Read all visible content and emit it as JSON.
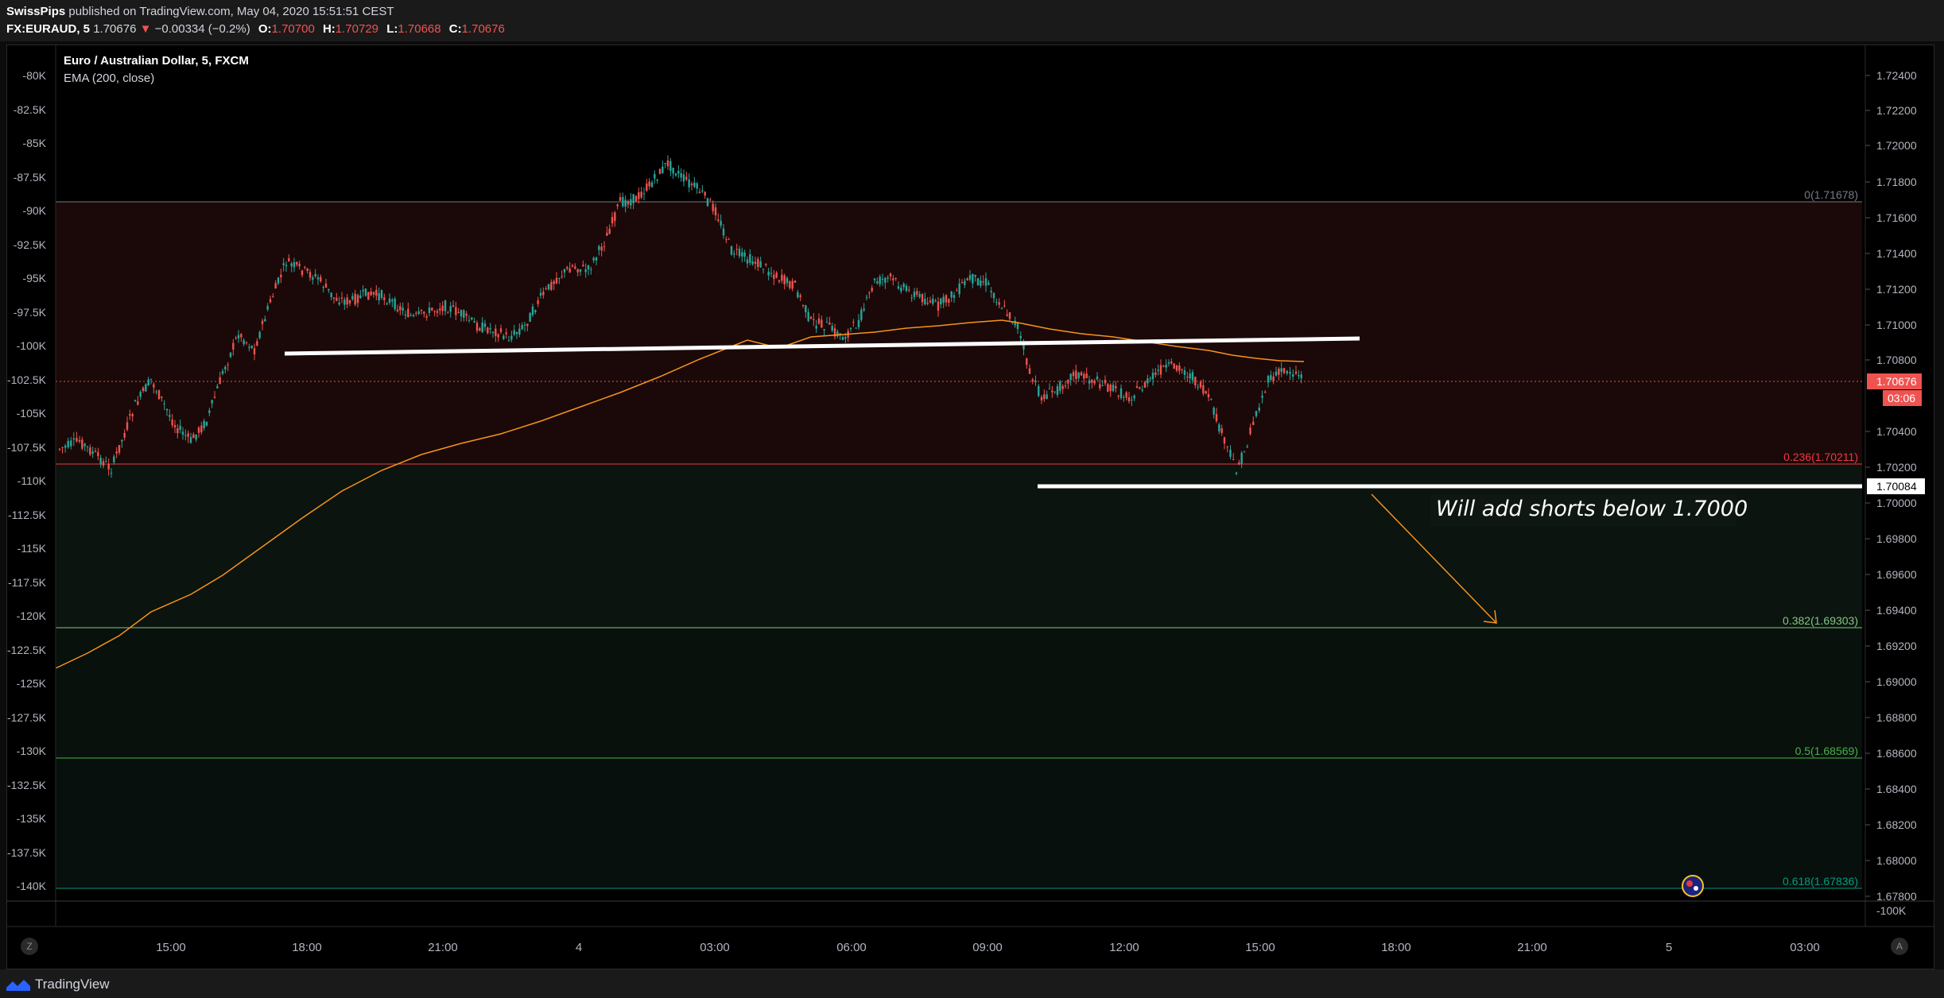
{
  "header": {
    "author": "SwissPips",
    "published_text": "published on TradingView.com, May 04, 2020 15:51:51 CEST",
    "symbol": "FX:EURAUD, 5",
    "last": "1.70676",
    "arrow": "▼",
    "change": "−0.00334 (−0.2%)",
    "o_label": "O:",
    "o_value": "1.70700",
    "h_label": "H:",
    "h_value": "1.70729",
    "l_label": "L:",
    "l_value": "1.70668",
    "c_label": "C:",
    "c_value": "1.70676"
  },
  "legend": {
    "title": "Euro / Australian Dollar, 5, FXCM",
    "indicator": "EMA (200, close)"
  },
  "annotation": {
    "text": "Will add shorts below 1.7000"
  },
  "price_scale": {
    "labels": [
      "1.72400",
      "1.72200",
      "1.72000",
      "1.71800",
      "1.71600",
      "1.71400",
      "1.71200",
      "1.71000",
      "1.70800",
      "1.70400",
      "1.70200",
      "1.70000",
      "1.69800",
      "1.69600",
      "1.69400",
      "1.69200",
      "1.69000",
      "1.68800",
      "1.68600",
      "1.68400",
      "1.68200",
      "1.68000",
      "1.67800"
    ],
    "current_price_tag": "1.70676",
    "countdown_tag": "03:06",
    "line_tag": "1.70084"
  },
  "left_scale": {
    "labels": [
      "-80K",
      "-82.5K",
      "-85K",
      "-87.5K",
      "-90K",
      "-92.5K",
      "-95K",
      "-97.5K",
      "-100K",
      "-102.5K",
      "-105K",
      "-107.5K",
      "-110K",
      "-112.5K",
      "-115K",
      "-117.5K",
      "-120K",
      "-122.5K",
      "-125K",
      "-127.5K",
      "-130K",
      "-132.5K",
      "-135K",
      "-137.5K",
      "-140K"
    ],
    "bottom_right_label": "-100K"
  },
  "fib_levels": [
    {
      "label": "0(1.71678)",
      "color": "#787b86"
    },
    {
      "label": "0.236(1.70211)",
      "color": "#f23645"
    },
    {
      "label": "0.382(1.69303)",
      "color": "#81c784"
    },
    {
      "label": "0.5(1.68569)",
      "color": "#4caf50"
    },
    {
      "label": "0.618(1.67836)",
      "color": "#089981"
    }
  ],
  "time_axis": {
    "labels": [
      "15:00",
      "18:00",
      "21:00",
      "4",
      "03:00",
      "06:00",
      "09:00",
      "12:00",
      "15:00",
      "18:00",
      "21:00",
      "5",
      "03:00"
    ]
  },
  "footer": {
    "brand": "TradingView",
    "left_button": "Z",
    "right_button": "A"
  },
  "colors": {
    "up": "#26a69a",
    "down": "#ef5350",
    "ema": "#f7931a",
    "accent_red": "#f23645"
  }
}
